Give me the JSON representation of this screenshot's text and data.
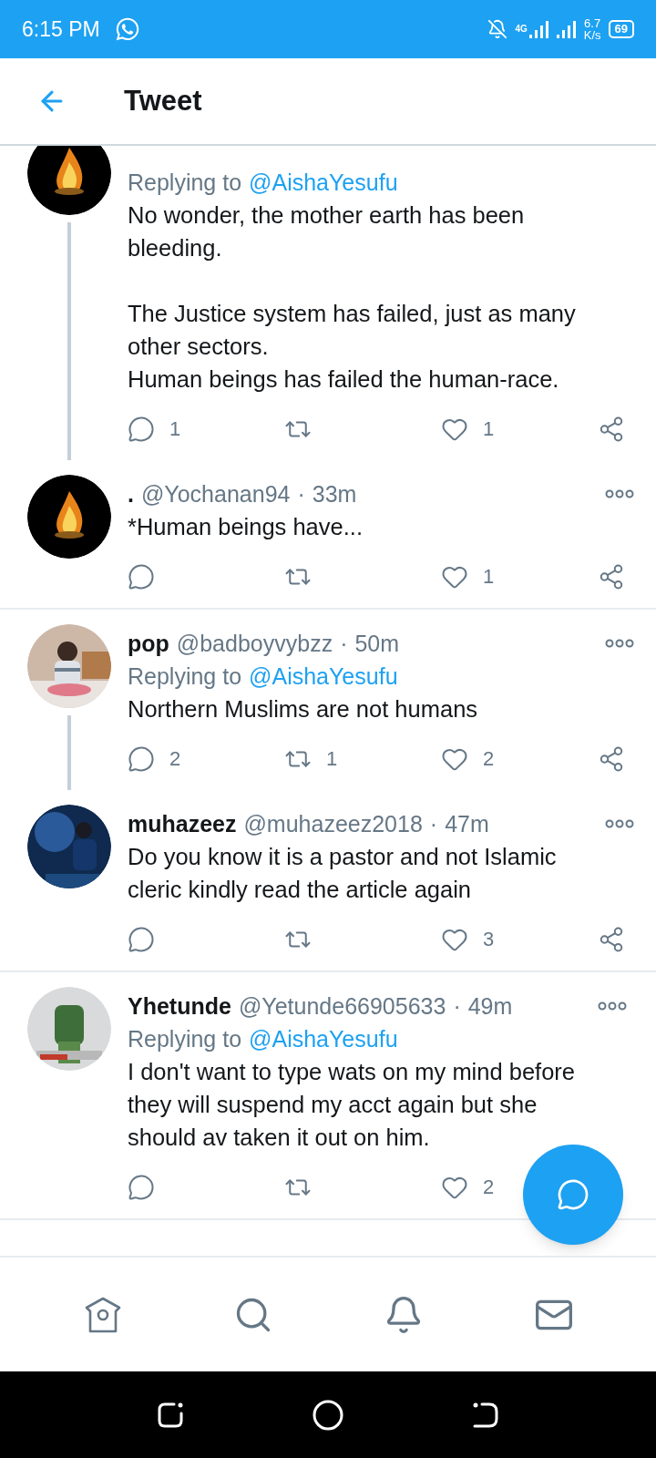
{
  "status_bar": {
    "time": "6:15 PM",
    "network": "4G",
    "speed": [
      "6.7",
      "K/s"
    ],
    "battery": "69"
  },
  "header": {
    "title": "Tweet"
  },
  "tweets": [
    {
      "replying_prefix": "Replying to",
      "replying_handle": "@AishaYesufu",
      "text": "No wonder, the mother earth has been bleeding.\n\nThe Justice system has failed, just as many other sectors.\nHuman beings has failed the human-race.",
      "replies": "1",
      "likes": "1",
      "thread_continues": true,
      "divider": false
    },
    {
      "name": ".",
      "handle": "@Yochanan94",
      "separator": "·",
      "time": "33m",
      "text": "*Human beings have...",
      "likes": "1",
      "thread_continues": false,
      "divider": true
    },
    {
      "name": "pop",
      "handle": "@badboyvybzz",
      "separator": "·",
      "time": "50m",
      "replying_prefix": "Replying to",
      "replying_handle": "@AishaYesufu",
      "text": "Northern Muslims are not humans",
      "replies": "2",
      "retweets": "1",
      "likes": "2",
      "thread_continues": true,
      "divider": false
    },
    {
      "name": "muhazeez",
      "handle": "@muhazeez2018",
      "separator": "·",
      "time": "47m",
      "text": "Do you know it is a pastor and not Islamic cleric kindly read the article again",
      "likes": "3",
      "thread_continues": false,
      "divider": true
    },
    {
      "name": "Yhetunde",
      "handle": "@Yetunde66905633",
      "separator": "·",
      "time": "49m",
      "replying_prefix": "Replying to",
      "replying_handle": "@AishaYesufu",
      "text": "I don't want to type wats on my mind before they will suspend my acct again but she should av taken it out on him.",
      "likes": "2",
      "thread_continues": false,
      "divider": true
    }
  ]
}
